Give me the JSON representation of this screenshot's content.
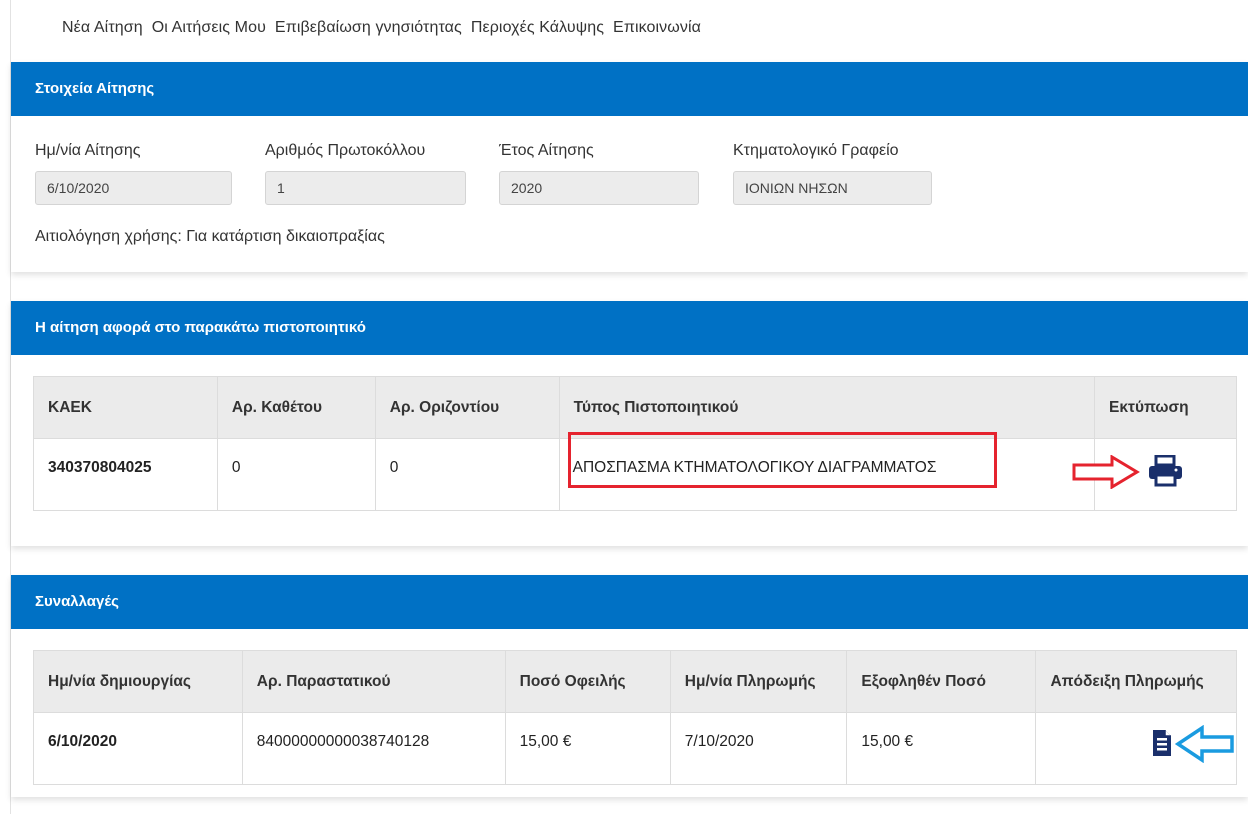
{
  "nav": {
    "items": [
      "Νέα Αίτηση",
      "Οι Αιτήσεις Μου",
      "Επιβεβαίωση γνησιότητας",
      "Περιοχές Κάλυψης",
      "Επικοινωνία"
    ]
  },
  "application": {
    "title": "Στοιχεία Αίτησης",
    "fields": [
      {
        "label": "Ημ/νία Αίτησης",
        "value": "6/10/2020"
      },
      {
        "label": "Αριθμός Πρωτοκόλλου",
        "value": "1"
      },
      {
        "label": "Έτος Αίτησης",
        "value": "2020"
      },
      {
        "label": "Κτηματολογικό Γραφείο",
        "value": "ΙΟΝΙΩΝ ΝΗΣΩΝ"
      }
    ],
    "reason": "Αιτιολόγηση χρήσης: Για κατάρτιση δικαιοπραξίας"
  },
  "certificate": {
    "title": "Η αίτηση αφορά στο παρακάτω πιστοποιητικό",
    "headers": [
      "ΚΑΕΚ",
      "Αρ. Καθέτου",
      "Αρ. Οριζοντίου",
      "Τύπος Πιστοποιητικού",
      "Εκτύπωση"
    ],
    "rows": [
      {
        "kaek": "340370804025",
        "vertical": "0",
        "horizontal": "0",
        "type": "ΑΠΟΣΠΑΣΜΑ ΚΤΗΜΑΤΟΛΟΓΙΚΟΥ ΔΙΑΓΡΑΜΜΑΤΟΣ",
        "print_icon": "print-icon"
      }
    ]
  },
  "transactions": {
    "title": "Συναλλαγές",
    "headers": [
      "Ημ/νία δημιουργίας",
      "Αρ. Παραστατικού",
      "Ποσό Οφειλής",
      "Ημ/νία Πληρωμής",
      "Εξοφληθέν Ποσό",
      "Απόδειξη Πληρωμής"
    ],
    "rows": [
      {
        "created": "6/10/2020",
        "doc_no": "84000000000038740128",
        "amount_due": "15,00 €",
        "paid_date": "7/10/2020",
        "paid_amount": "15,00 €",
        "receipt_icon": "receipt-icon"
      }
    ]
  },
  "colors": {
    "header_blue": "#0071c5",
    "icon_navy": "#1a2f6b",
    "annotation_red": "#e5232e",
    "annotation_cyan": "#1a9be0"
  }
}
